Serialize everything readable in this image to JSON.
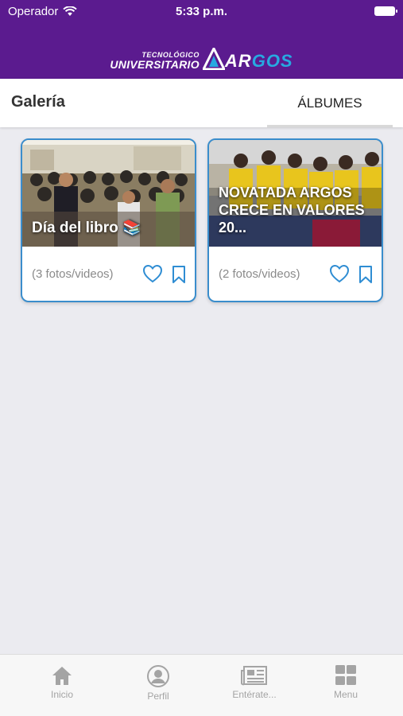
{
  "status_bar": {
    "carrier": "Operador",
    "time": "5:33 p.m."
  },
  "header": {
    "logo_line1": "TECNOLÓGICO",
    "logo_line2": "UNIVERSITARIO",
    "brand_ar": "AR",
    "brand_gos": "GOS",
    "brand_color": "#5b1b8f",
    "accent_color": "#27a9e1"
  },
  "page": {
    "title": "Galería",
    "tab_label": "ÁLBUMES"
  },
  "albums": [
    {
      "caption": "Día del libro 📚",
      "count": "(3 fotos/videos)",
      "icons": [
        "heart-icon",
        "bookmark-icon"
      ]
    },
    {
      "caption": "NOVATADA ARGOS CRECE EN VALORES 20...",
      "count": "(2 fotos/videos)",
      "icons": [
        "heart-icon",
        "bookmark-icon"
      ]
    }
  ],
  "tab_bar": {
    "items": [
      {
        "label": "Inicio",
        "icon": "home-icon"
      },
      {
        "label": "Perfil",
        "icon": "profile-icon"
      },
      {
        "label": "Entérate...",
        "icon": "newspaper-icon"
      },
      {
        "label": "Menu",
        "icon": "grid-icon"
      }
    ]
  }
}
